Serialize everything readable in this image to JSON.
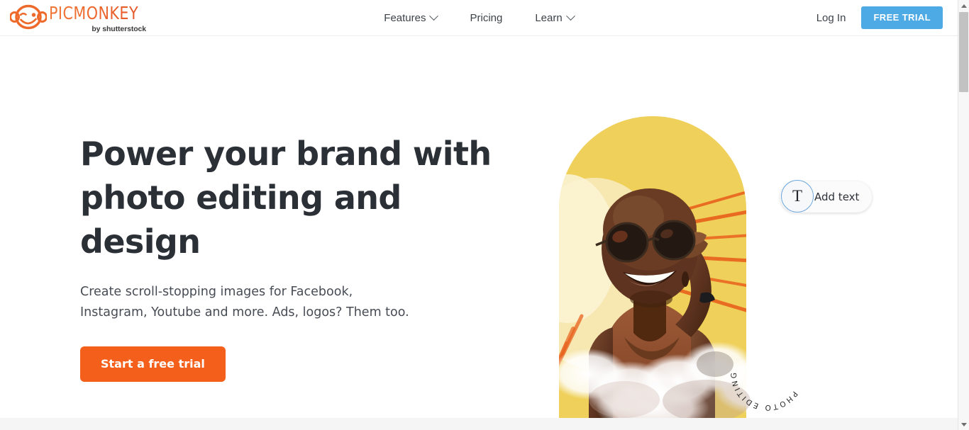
{
  "header": {
    "logo": {
      "wordmark": "PICMONKEY",
      "tagline": "by shutterstock",
      "icon": "monkey-face-icon",
      "brand_color": "#ee6a2c"
    },
    "nav": [
      {
        "label": "Features",
        "has_dropdown": true
      },
      {
        "label": "Pricing",
        "has_dropdown": false
      },
      {
        "label": "Learn",
        "has_dropdown": true
      }
    ],
    "login_label": "Log In",
    "free_trial_label": "FREE TRIAL",
    "free_trial_color": "#4daae4"
  },
  "hero": {
    "title_line1": "Power your brand with",
    "title_line2": "photo editing and design",
    "subtitle_line1": "Create scroll-stopping images for Facebook,",
    "subtitle_line2": "Instagram, Youtube and more. Ads, logos? Them too.",
    "cta_label": "Start a free trial",
    "cta_color": "#f4601b",
    "title_color": "#2b2f36"
  },
  "hero_art": {
    "alt": "Smiling woman wearing round sunglasses in front of a yellow arch with orange sun rays and clouds",
    "arch_color": "#efd05a",
    "ray_color": "#e8621d",
    "cloud_color": "#ffffff",
    "add_text_label": "Add text",
    "add_text_badge_glyph": "T",
    "badge_ring_text": "PHOTO EDITING • DE"
  },
  "scrollbar": {
    "up_arrow": "scroll-up-arrow",
    "down_arrow": "scroll-down-arrow"
  }
}
